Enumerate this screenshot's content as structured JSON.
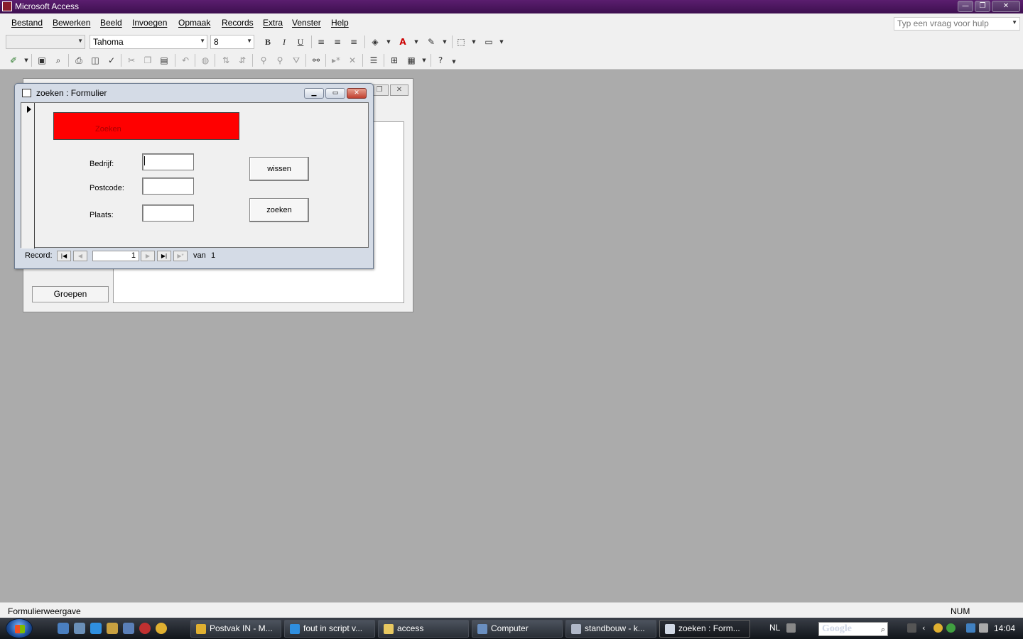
{
  "app": {
    "title": "Microsoft Access"
  },
  "menu": [
    "Bestand",
    "Bewerken",
    "Beeld",
    "Invoegen",
    "Opmaak",
    "Records",
    "Extra",
    "Venster",
    "Help"
  ],
  "help_box": {
    "placeholder": "Typ een vraag voor hulp"
  },
  "toolbar": {
    "font_name": "Tahoma",
    "font_size": "8"
  },
  "background_form": {
    "groepen_label": "Groepen"
  },
  "dialog": {
    "title": "zoeken : Formulier",
    "header_label": "Zoeken",
    "fields": [
      {
        "label": "Bedrijf:",
        "value": ""
      },
      {
        "label": "Postcode:",
        "value": ""
      },
      {
        "label": "Plaats:",
        "value": ""
      }
    ],
    "buttons": {
      "wissen": "wissen",
      "zoeken": "zoeken"
    },
    "navigation": {
      "record_label": "Record:",
      "current": "1",
      "of_label": "van",
      "total": "1"
    },
    "colors": {
      "header_bg": "#ff0000"
    }
  },
  "statusbar": {
    "mode": "Formulierweergave",
    "num": "NUM"
  },
  "taskbar": {
    "tasks": [
      "Postvak IN - M...",
      "fout in script v...",
      "access",
      "Computer",
      "standbouw - k...",
      "zoeken : Form..."
    ],
    "language": "NL",
    "search_placeholder": "Google",
    "clock": "14:04"
  }
}
